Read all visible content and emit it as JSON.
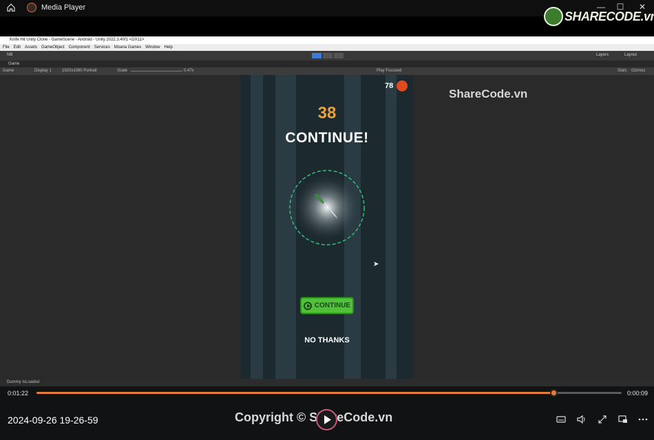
{
  "player": {
    "title": "Media Player",
    "current_time": "0:01:22",
    "remaining_time": "0:00:09",
    "progress_fraction": 0.884,
    "recording_name": "2024-09-26 19-26-59",
    "window_controls": [
      "minimize",
      "maximize",
      "close"
    ],
    "icons": [
      "home-icon",
      "app-icon",
      "play-icon",
      "subtitles-icon",
      "volume-icon",
      "fullscreen-icon",
      "miniplayer-icon",
      "more-icon"
    ]
  },
  "watermark": {
    "logo_text": "SHARECODE.vn",
    "site_text": "ShareCode.vn",
    "copyright": "Copyright © ShareCode.vn"
  },
  "unity": {
    "window_title": "Knife Hit Unity Clone - GameScene - Android - Unity 2022.3.40f1 <DX11>",
    "menu": [
      "File",
      "Edit",
      "Assets",
      "GameObject",
      "Component",
      "Services",
      "Moana Games",
      "Window",
      "Help"
    ],
    "toolbar": {
      "account": "NB",
      "layers": "Layers",
      "layout": "Layout"
    },
    "tab": "Game",
    "game_bar": {
      "view": "Game",
      "display": "Display 1",
      "resolution": "1920x1080 Portrait",
      "scale_label": "Scale",
      "scale_value": "0.47x",
      "play_focused": "Play Focused",
      "stats": "Stats",
      "gizmos": "Gizmos"
    },
    "status": "Dummy IsLoaded"
  },
  "game": {
    "coins": "78",
    "score": "38",
    "heading": "CONTINUE!",
    "continue_button": "CONTINUE",
    "no_thanks": "NO THANKS",
    "colors": {
      "score": "#eaa23a",
      "button": "#4fc23a",
      "ring": "#2fc27a",
      "bg": "#1c2a30"
    }
  }
}
